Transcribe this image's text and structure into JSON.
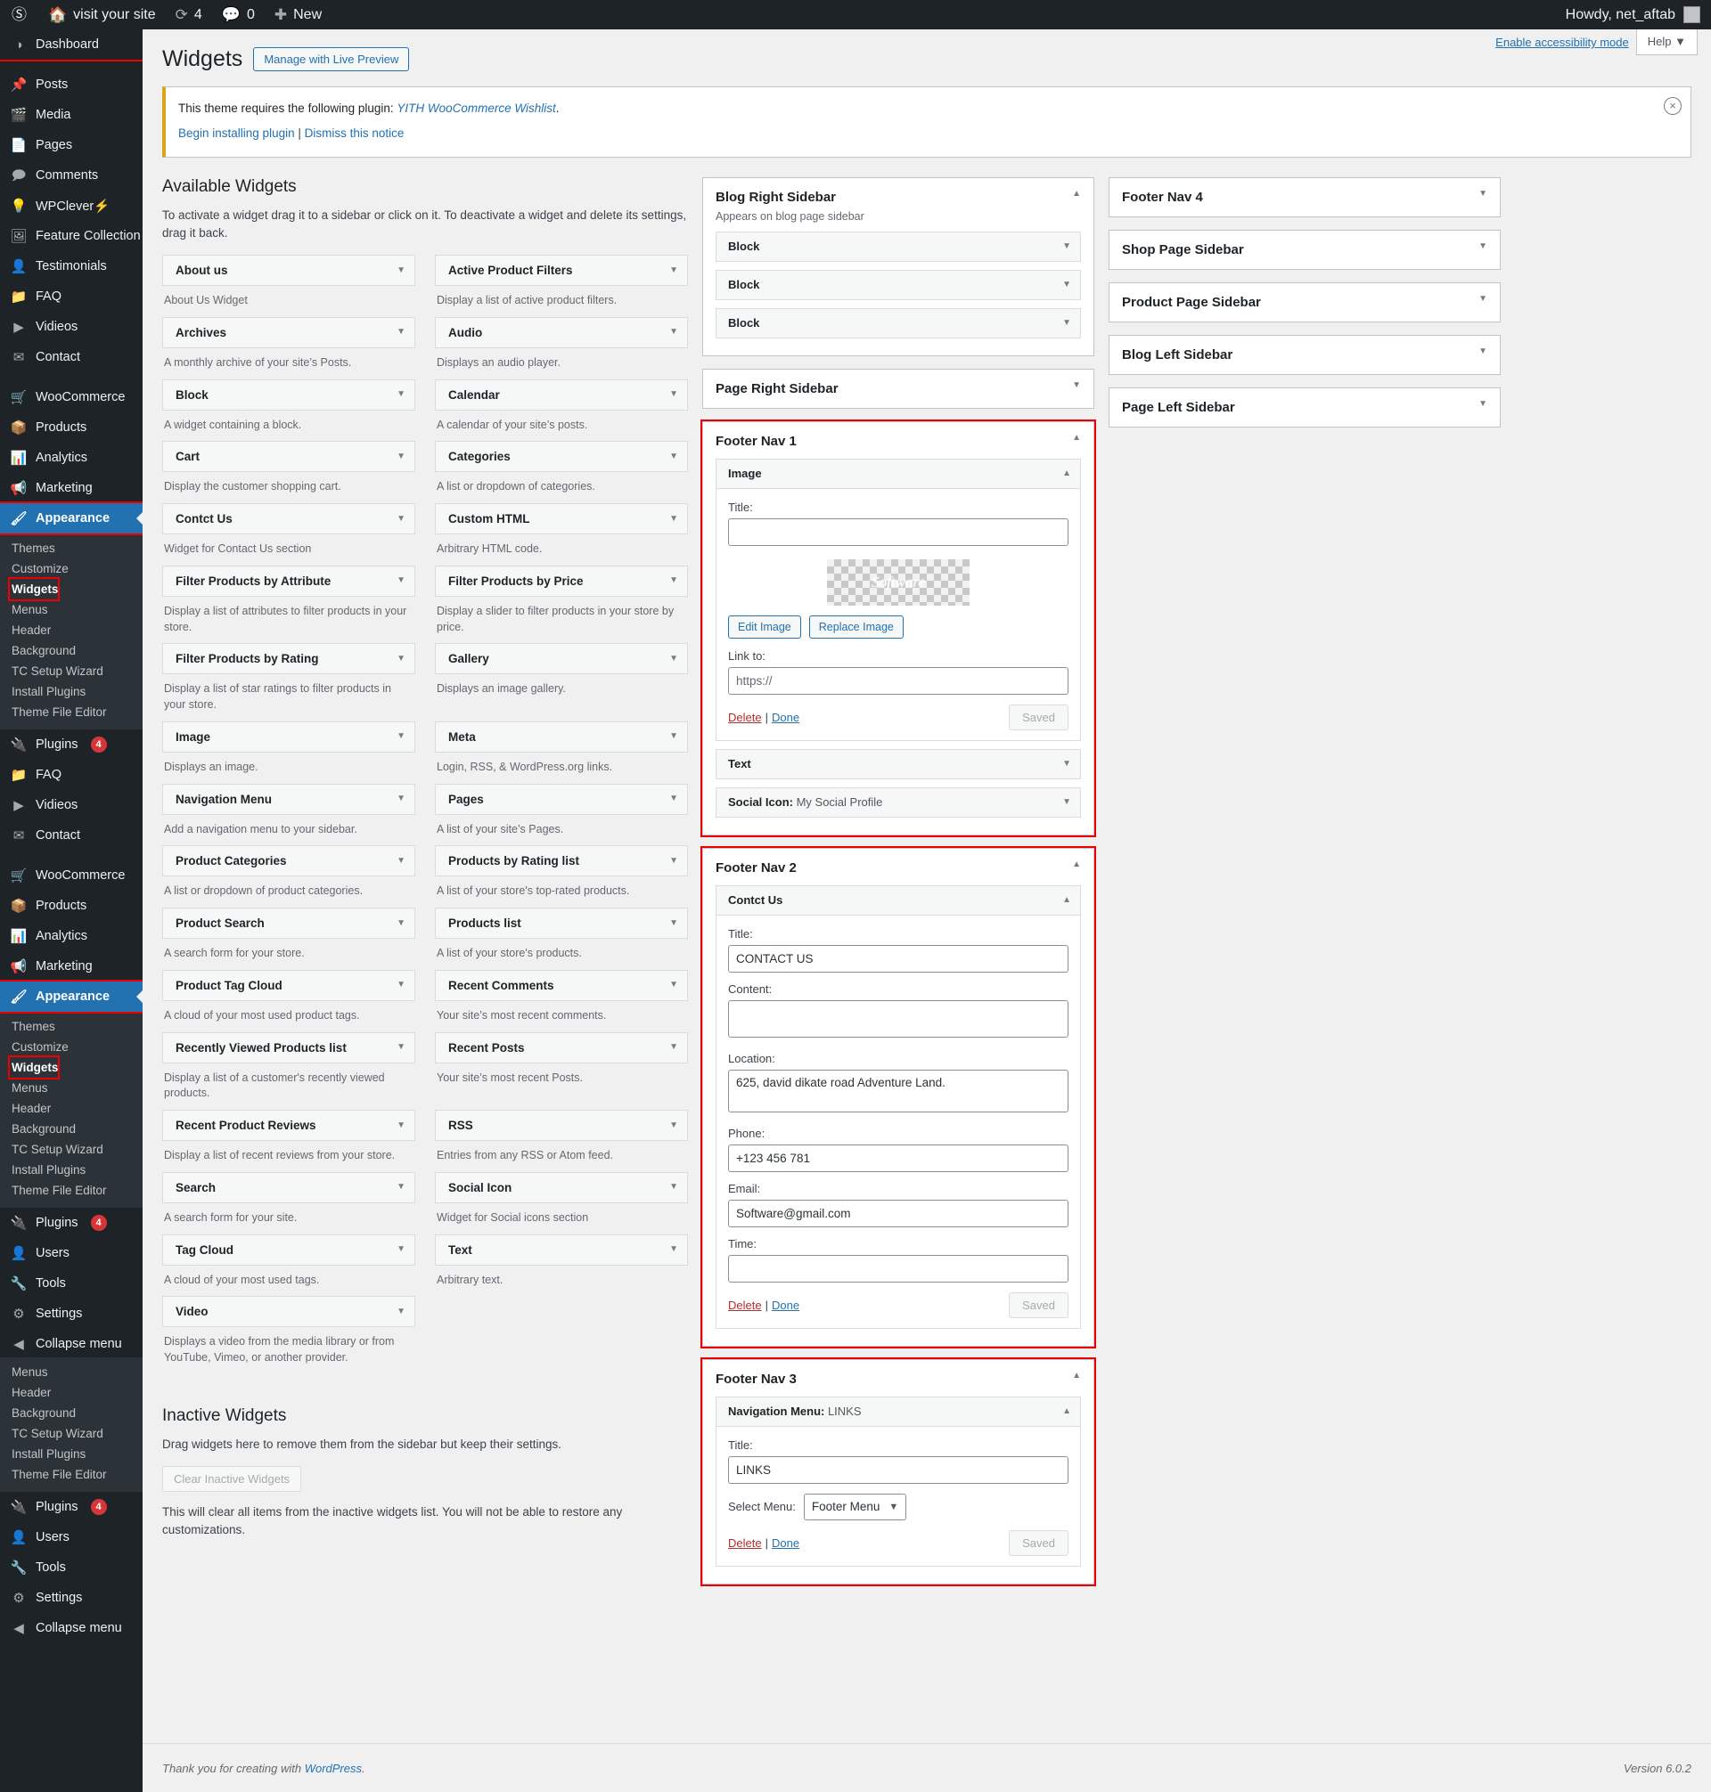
{
  "adminbar": {
    "wp_logo": "wordpress-logo",
    "site_name": "visit your site",
    "updates_count": "4",
    "comments_count": "0",
    "new_label": "New",
    "howdy": "Howdy, net_aftab"
  },
  "adminmenu": {
    "groups": [
      {
        "items": [
          {
            "label": "Dashboard",
            "icon": "dashboard-icon",
            "current": false,
            "highlight": true
          },
          {
            "label": "Posts",
            "icon": "pin-icon"
          },
          {
            "label": "Media",
            "icon": "media-icon"
          },
          {
            "label": "Pages",
            "icon": "pages-icon"
          },
          {
            "label": "Comments",
            "icon": "comment-icon"
          },
          {
            "label": "WPClever⚡",
            "icon": "lightbulb-icon"
          },
          {
            "label": "Feature Collection",
            "icon": "images-icon"
          },
          {
            "label": "Testimonials",
            "icon": "user-icon"
          },
          {
            "label": "FAQ",
            "icon": "folder-icon"
          },
          {
            "label": "Vidieos",
            "icon": "video-icon"
          },
          {
            "label": "Contact",
            "icon": "envelope-icon"
          }
        ]
      },
      {
        "items": [
          {
            "label": "WooCommerce",
            "icon": "woo-icon"
          },
          {
            "label": "Products",
            "icon": "product-icon"
          },
          {
            "label": "Analytics",
            "icon": "chart-icon"
          },
          {
            "label": "Marketing",
            "icon": "megaphone-icon"
          }
        ]
      }
    ],
    "appearance": {
      "label": "Appearance",
      "icon": "brush-icon"
    },
    "appearance_sub": [
      {
        "label": "Themes"
      },
      {
        "label": "Customize"
      },
      {
        "label": "Widgets",
        "current": true
      },
      {
        "label": "Menus"
      },
      {
        "label": "Header"
      },
      {
        "label": "Background"
      },
      {
        "label": "TC Setup Wizard"
      },
      {
        "label": "Install Plugins"
      },
      {
        "label": "Theme File Editor"
      }
    ],
    "tail": [
      {
        "label": "Plugins",
        "icon": "plug-icon",
        "badge": "4"
      },
      {
        "label": "Users",
        "icon": "user-icon"
      },
      {
        "label": "Tools",
        "icon": "wrench-icon"
      },
      {
        "label": "Settings",
        "icon": "settings-icon"
      },
      {
        "label": "Collapse menu",
        "icon": "collapse-icon"
      }
    ]
  },
  "header": {
    "title": "Widgets",
    "live_preview_label": "Manage with Live Preview",
    "accessibility_link": "Enable accessibility mode",
    "help_label": "Help",
    "help_caret": "▼"
  },
  "notice": {
    "text_before": "This theme requires the following plugin: ",
    "plugin_link": "YITH WooCommerce Wishlist",
    "text_after": ".",
    "begin_link": "Begin installing plugin",
    "separator": "|",
    "dismiss_link": "Dismiss this notice",
    "close_icon": "×"
  },
  "available": {
    "heading": "Available Widgets",
    "description": "To activate a widget drag it to a sidebar or click on it. To deactivate a widget and delete its settings, drag it back.",
    "caret": "▼",
    "widgets": [
      {
        "name": "About us",
        "desc": "About Us Widget"
      },
      {
        "name": "Active Product Filters",
        "desc": "Display a list of active product filters."
      },
      {
        "name": "Archives",
        "desc": "A monthly archive of your site’s Posts."
      },
      {
        "name": "Audio",
        "desc": "Displays an audio player."
      },
      {
        "name": "Block",
        "desc": "A widget containing a block."
      },
      {
        "name": "Calendar",
        "desc": "A calendar of your site’s posts."
      },
      {
        "name": "Cart",
        "desc": "Display the customer shopping cart."
      },
      {
        "name": "Categories",
        "desc": "A list or dropdown of categories."
      },
      {
        "name": "Contct Us",
        "desc": "Widget for Contact Us section"
      },
      {
        "name": "Custom HTML",
        "desc": "Arbitrary HTML code."
      },
      {
        "name": "Filter Products by Attribute",
        "desc": "Display a list of attributes to filter products in your store."
      },
      {
        "name": "Filter Products by Price",
        "desc": "Display a slider to filter products in your store by price."
      },
      {
        "name": "Filter Products by Rating",
        "desc": "Display a list of star ratings to filter products in your store."
      },
      {
        "name": "Gallery",
        "desc": "Displays an image gallery."
      },
      {
        "name": "Image",
        "desc": "Displays an image."
      },
      {
        "name": "Meta",
        "desc": "Login, RSS, & WordPress.org links."
      },
      {
        "name": "Navigation Menu",
        "desc": "Add a navigation menu to your sidebar."
      },
      {
        "name": "Pages",
        "desc": "A list of your site’s Pages."
      },
      {
        "name": "Product Categories",
        "desc": "A list or dropdown of product categories."
      },
      {
        "name": "Products by Rating list",
        "desc": "A list of your store's top-rated products."
      },
      {
        "name": "Product Search",
        "desc": "A search form for your store."
      },
      {
        "name": "Products list",
        "desc": "A list of your store's products."
      },
      {
        "name": "Product Tag Cloud",
        "desc": "A cloud of your most used product tags."
      },
      {
        "name": "Recent Comments",
        "desc": "Your site’s most recent comments."
      },
      {
        "name": "Recently Viewed Products list",
        "desc": "Display a list of a customer's recently viewed products."
      },
      {
        "name": "Recent Posts",
        "desc": "Your site’s most recent Posts."
      },
      {
        "name": "Recent Product Reviews",
        "desc": "Display a list of recent reviews from your store."
      },
      {
        "name": "RSS",
        "desc": "Entries from any RSS or Atom feed."
      },
      {
        "name": "Search",
        "desc": "A search form for your site."
      },
      {
        "name": "Social Icon",
        "desc": "Widget for Social icons section"
      },
      {
        "name": "Tag Cloud",
        "desc": "A cloud of your most used tags."
      },
      {
        "name": "Text",
        "desc": "Arbitrary text."
      },
      {
        "name": "Video",
        "desc": "Displays a video from the media library or from YouTube, Vimeo, or another provider."
      }
    ]
  },
  "inactive": {
    "heading": "Inactive Widgets",
    "description": "Drag widgets here to remove them from the sidebar but keep their settings.",
    "clear_label": "Clear Inactive Widgets",
    "note": "This will clear all items from the inactive widgets list. You will not be able to restore any customizations."
  },
  "carets": {
    "up": "▲",
    "down": "▼"
  },
  "labels": {
    "title": "Title:",
    "content": "Content:",
    "location": "Location:",
    "phone": "Phone:",
    "email": "Email:",
    "time": "Time:",
    "link_to": "Link to:",
    "select_menu": "Select Menu:",
    "delete": "Delete",
    "pipe": "|",
    "done": "Done",
    "saved": "Saved",
    "edit_image": "Edit Image",
    "replace_image": "Replace Image"
  },
  "sidebars_mid": [
    {
      "name": "Blog Right Sidebar",
      "desc": "Appears on blog page sidebar",
      "open": true,
      "highlight": false,
      "widgets": [
        {
          "title": "Block",
          "open": false
        },
        {
          "title": "Block",
          "open": false
        },
        {
          "title": "Block",
          "open": false
        }
      ]
    },
    {
      "name": "Page Right Sidebar",
      "open": false,
      "highlight": false,
      "widgets": []
    },
    {
      "name": "Footer Nav 1",
      "open": true,
      "highlight": true,
      "widgets": [
        {
          "title": "Image",
          "open": true,
          "form": "image",
          "fields": {
            "title_value": "",
            "image_placeholder_text": "Software",
            "link_to_value": "https://"
          }
        },
        {
          "title": "Text",
          "open": false
        },
        {
          "title": "Social Icon: ",
          "subtitle": "My Social Profile",
          "open": false
        }
      ]
    },
    {
      "name": "Footer Nav 2",
      "open": true,
      "highlight": true,
      "widgets": [
        {
          "title": "Contct Us",
          "open": true,
          "form": "contact",
          "fields": {
            "title_value": "CONTACT US",
            "content_value": "",
            "location_value": "625, david dikate road Adventure Land.",
            "phone_value": "+123 456 781",
            "email_value": "Software@gmail.com",
            "time_value": ""
          }
        }
      ]
    },
    {
      "name": "Footer Nav 3",
      "open": true,
      "highlight": true,
      "widgets": [
        {
          "title": "Navigation Menu: ",
          "subtitle": "LINKS",
          "open": true,
          "form": "navmenu",
          "fields": {
            "title_value": "LINKS",
            "selected_menu": "Footer Menu"
          }
        }
      ]
    }
  ],
  "sidebars_right": [
    {
      "name": "Footer Nav 4"
    },
    {
      "name": "Shop Page Sidebar"
    },
    {
      "name": "Product Page Sidebar"
    },
    {
      "name": "Blog Left Sidebar"
    },
    {
      "name": "Page Left Sidebar"
    }
  ],
  "footer": {
    "thanks_before": "Thank you for creating with ",
    "wp_link": "WordPress",
    "thanks_after": ".",
    "version": "Version 6.0.2"
  },
  "colors": {
    "menu_bg": "#1d2327",
    "accent": "#2271b1",
    "highlight": "#e00000",
    "notice_border": "#dba617",
    "delete": "#b32d2e"
  }
}
